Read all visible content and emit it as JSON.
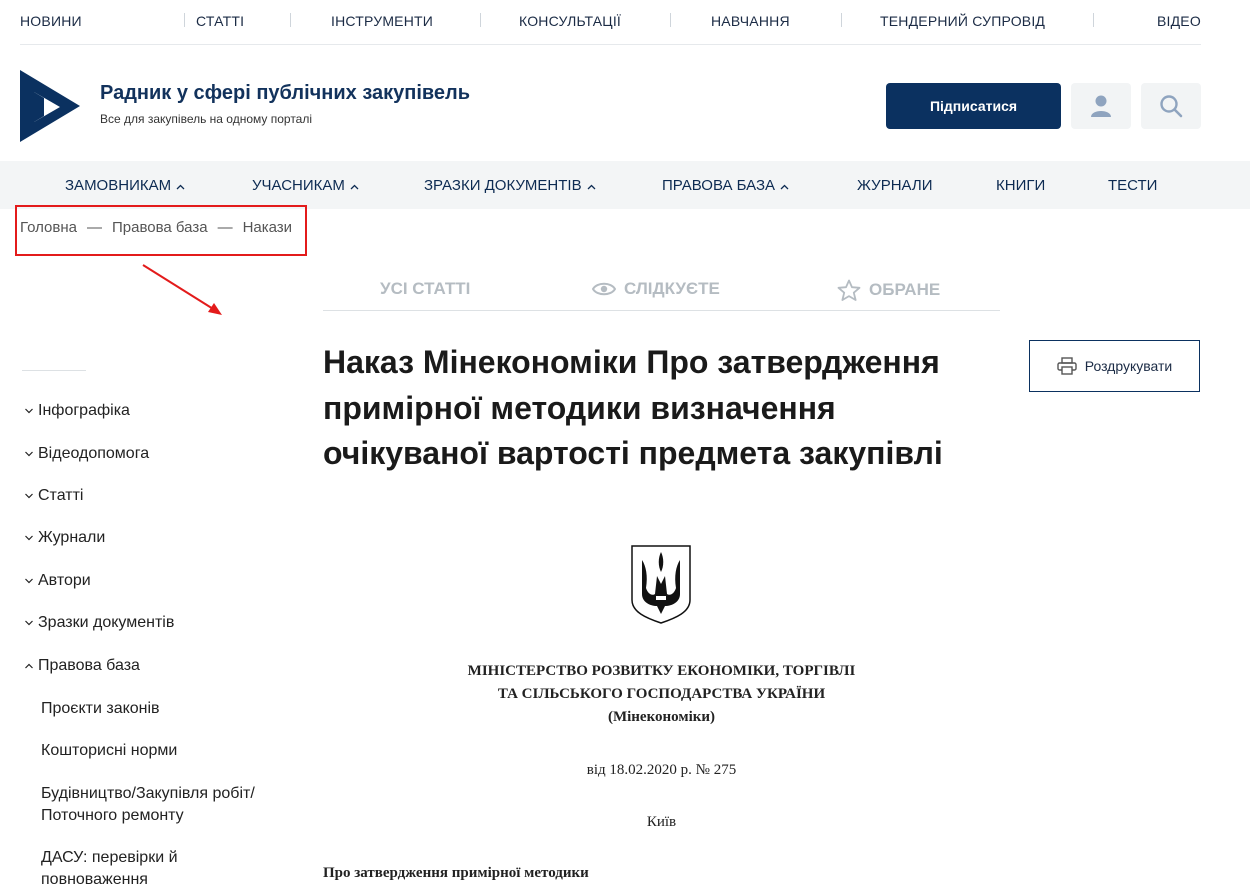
{
  "top_nav": [
    "НОВИНИ",
    "СТАТТІ",
    "ІНСТРУМЕНТИ",
    "КОНСУЛЬТАЦІЇ",
    "НАВЧАННЯ",
    "ТЕНДЕРНИЙ СУПРОВІД",
    "ВІДЕО"
  ],
  "header": {
    "title": "Радник у сфері публічних закупівель",
    "subtitle": "Все для закупівель на одному порталі",
    "subscribe_label": "Підписатися",
    "icons": {
      "user": "user-icon",
      "search": "search-icon"
    }
  },
  "main_nav": [
    {
      "label": "ЗАМОВНИКАМ",
      "dropdown": true
    },
    {
      "label": "УЧАСНИКАМ",
      "dropdown": true
    },
    {
      "label": "ЗРАЗКИ ДОКУМЕНТІВ",
      "dropdown": true
    },
    {
      "label": "ПРАВОВА БАЗА",
      "dropdown": true
    },
    {
      "label": "ЖУРНАЛИ",
      "dropdown": false
    },
    {
      "label": "КНИГИ",
      "dropdown": false
    },
    {
      "label": "ТЕСТИ",
      "dropdown": false
    }
  ],
  "breadcrumb": {
    "items": [
      "Головна",
      "Правова база",
      "Накази"
    ],
    "separator": "—"
  },
  "tabs": [
    {
      "label": "УСІ СТАТТІ",
      "icon": ""
    },
    {
      "label": "СЛІДКУЄТЕ",
      "icon": "eye-icon"
    },
    {
      "label": "ОБРАНЕ",
      "icon": "star-icon"
    }
  ],
  "sidebar": {
    "items": [
      "Інфографіка",
      "Відеодопомога",
      "Статті",
      "Журнали",
      "Автори",
      "Зразки документів",
      "Правова база"
    ],
    "expanded": "Правова база",
    "subitems": [
      "Проєкти законів",
      "Кошторисні норми",
      "Будівництво/Закупівля робіт/ Поточного ремонту",
      "ДАСУ: перевірки й повноваження"
    ]
  },
  "article": {
    "title": "Наказ Мінекономіки Про затвердження примірної методики визначення очікуваної вартості предмета закупівлі",
    "print_label": "Роздрукувати",
    "ministry_line1": "МІНІСТЕРСТВО РОЗВИТКУ ЕКОНОМІКИ, ТОРГІВЛІ",
    "ministry_line2": "ТА СІЛЬСЬКОГО ГОСПОДАРСТВА УКРАЇНИ",
    "ministry_line3": "(Мінекономіки)",
    "date_line": "від 18.02.2020 р. № 275",
    "city": "Київ",
    "doc_heading": "Про затвердження примірної методики"
  },
  "colors": {
    "brand": "#0b3160",
    "highlight": "#e31b1b",
    "nav_bg": "#f3f5f6",
    "tab_inactive": "#b5bcc2"
  }
}
